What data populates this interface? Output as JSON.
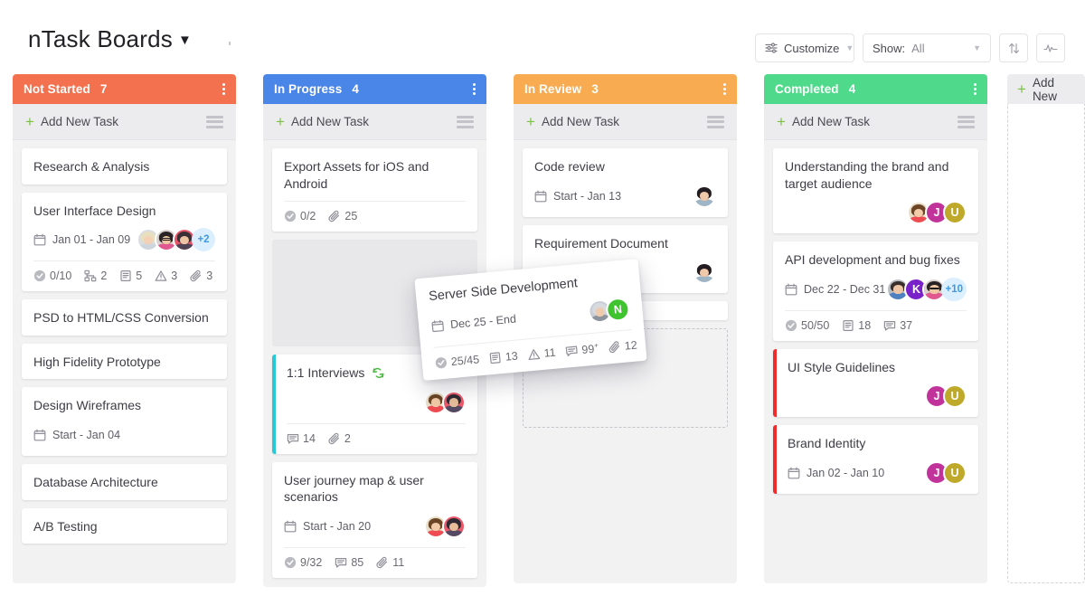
{
  "header": {
    "board_title": "nTask Boards",
    "caret_icon": "chevron-down-icon",
    "customize_label": "Customize",
    "customize_icon": "sliders-icon",
    "show_label": "Show:",
    "show_value": "All",
    "sort_icon": "sort-arrows-icon",
    "activity_icon": "activity-pulse-icon"
  },
  "add_column": {
    "label": "Add New",
    "plus": "+"
  },
  "add_task_label": "Add New Task",
  "columns": [
    {
      "name": "Not Started",
      "count": "7",
      "color": "#f4714f",
      "cards": [
        {
          "title": "Research & Analysis"
        },
        {
          "title": "User Interface Design",
          "date": "Jan 01 - Jan 09",
          "avatars": [
            {
              "type": "photo",
              "tone": "blonde"
            },
            {
              "type": "photo",
              "tone": "glasses"
            },
            {
              "type": "photo",
              "tone": "redman"
            }
          ],
          "more": "+2",
          "meta": [
            {
              "icon": "check-circle-icon",
              "value": "0/10"
            },
            {
              "icon": "subtask-icon",
              "value": "2"
            },
            {
              "icon": "document-icon",
              "value": "5"
            },
            {
              "icon": "warning-triangle-icon",
              "value": "3"
            },
            {
              "icon": "paperclip-icon",
              "value": "3"
            }
          ]
        },
        {
          "title": "PSD to HTML/CSS Conversion"
        },
        {
          "title": "High Fidelity Prototype"
        },
        {
          "title": "Design Wireframes",
          "date": "Start - Jan 04"
        },
        {
          "title": "Database Architecture"
        },
        {
          "title": "A/B Testing"
        }
      ]
    },
    {
      "name": "In Progress",
      "count": "4",
      "color": "#4a86e8",
      "cards": [
        {
          "title": "Export Assets for iOS and Android",
          "meta": [
            {
              "icon": "check-circle-icon",
              "value": "0/2"
            },
            {
              "icon": "paperclip-icon",
              "value": "25"
            }
          ]
        },
        {
          "placeholder": "grey"
        },
        {
          "title": "1:1 Interviews",
          "accent": "#27c9d6",
          "repeat_icon": "repeat-icon",
          "avatars": [
            {
              "type": "photo",
              "tone": "womanred"
            },
            {
              "type": "photo",
              "tone": "manpurple"
            }
          ],
          "meta": [
            {
              "icon": "comment-icon",
              "value": "14"
            },
            {
              "icon": "paperclip-icon",
              "value": "2"
            }
          ]
        },
        {
          "title": "User journey map & user scenarios",
          "date": "Start - Jan 20",
          "avatars": [
            {
              "type": "photo",
              "tone": "womanred"
            },
            {
              "type": "photo",
              "tone": "manpurple"
            }
          ],
          "meta": [
            {
              "icon": "check-circle-icon",
              "value": "9/32"
            },
            {
              "icon": "comment-icon",
              "value": "85"
            },
            {
              "icon": "paperclip-icon",
              "value": "11"
            }
          ]
        }
      ]
    },
    {
      "name": "In Review",
      "count": "3",
      "color": "#f9ab51",
      "cards": [
        {
          "title": "Code review",
          "date": "Start - Jan 13",
          "avatars": [
            {
              "type": "photo",
              "tone": "darkhair"
            }
          ]
        },
        {
          "title": "Requirement Document",
          "avatars": [
            {
              "type": "photo",
              "tone": "darkhair"
            }
          ]
        },
        {
          "title": ""
        },
        {
          "placeholder": "dashed"
        }
      ]
    },
    {
      "name": "Completed",
      "count": "4",
      "color": "#4fd98a",
      "cards": [
        {
          "title": "Understanding the brand and target audience",
          "avatars": [
            {
              "type": "photo",
              "tone": "womanred"
            },
            {
              "type": "letter",
              "letter": "J",
              "color": "#c2329b"
            },
            {
              "type": "letter",
              "letter": "U",
              "color": "#bfa92b"
            }
          ]
        },
        {
          "title": "API development and bug fixes",
          "date": "Dec 22 - Dec 31",
          "avatars": [
            {
              "type": "photo",
              "tone": "bluemanv"
            },
            {
              "type": "letter",
              "letter": "K",
              "color": "#7a22c9"
            },
            {
              "type": "photo",
              "tone": "glasses"
            }
          ],
          "more": "+10",
          "meta": [
            {
              "icon": "check-circle-icon",
              "value": "50/50"
            },
            {
              "icon": "document-icon",
              "value": "18"
            },
            {
              "icon": "comment-icon",
              "value": "37"
            }
          ]
        },
        {
          "title": "UI Style Guidelines",
          "accent": "#ef2b2b",
          "avatars": [
            {
              "type": "letter",
              "letter": "J",
              "color": "#c2329b"
            },
            {
              "type": "letter",
              "letter": "U",
              "color": "#bfa92b"
            }
          ]
        },
        {
          "title": "Brand Identity",
          "accent": "#ef2b2b",
          "date": "Jan 02 - Jan 10",
          "avatars": [
            {
              "type": "letter",
              "letter": "J",
              "color": "#c2329b"
            },
            {
              "type": "letter",
              "letter": "U",
              "color": "#bfa92b"
            }
          ]
        }
      ]
    }
  ],
  "drag_card": {
    "title": "Server Side Development",
    "date": "Dec 25 - End",
    "avatars": [
      {
        "type": "photo",
        "tone": "oldman"
      },
      {
        "type": "letter",
        "letter": "N",
        "color": "#3fc32f"
      }
    ],
    "meta": [
      {
        "icon": "check-circle-icon",
        "value": "25/45"
      },
      {
        "icon": "document-icon",
        "value": "13"
      },
      {
        "icon": "warning-triangle-icon",
        "value": "11"
      },
      {
        "icon": "comment-icon",
        "value": "99",
        "sup": "+"
      },
      {
        "icon": "paperclip-icon",
        "value": "12"
      }
    ]
  }
}
